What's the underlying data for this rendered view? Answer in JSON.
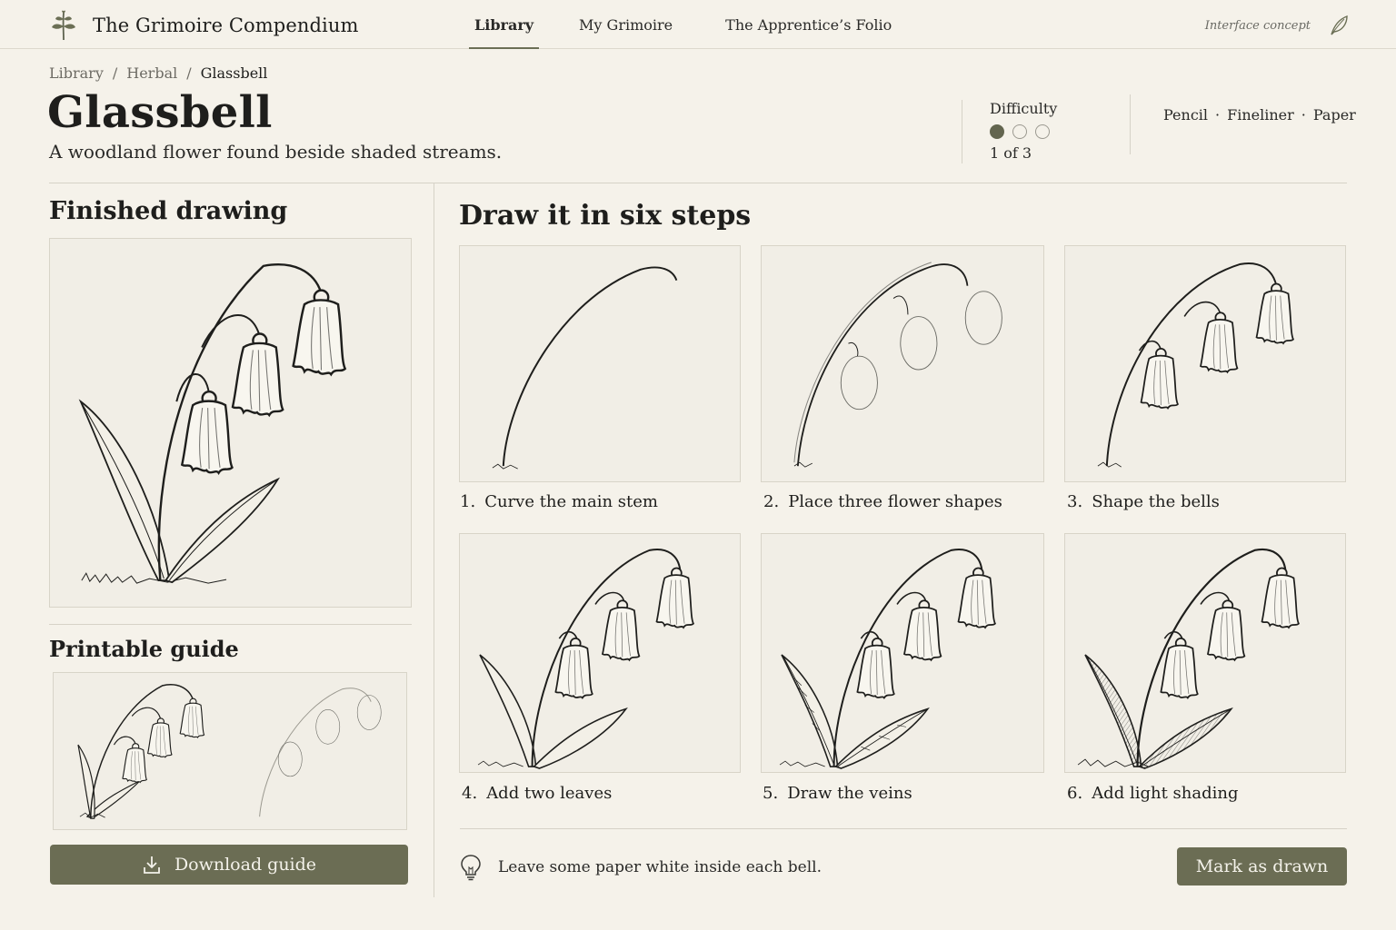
{
  "app": {
    "title": "The Grimoire Compendium",
    "concept_note": "Interface concept"
  },
  "nav": {
    "items": [
      {
        "label": "Library",
        "active": true
      },
      {
        "label": "My Grimoire",
        "active": false
      },
      {
        "label": "The Apprentice’s Folio",
        "active": false
      }
    ]
  },
  "breadcrumb": {
    "items": [
      "Library",
      "Herbal",
      "Glassbell"
    ],
    "separator": "/"
  },
  "entry": {
    "title": "Glassbell",
    "subtitle": "A woodland flower found beside shaded streams."
  },
  "difficulty": {
    "label": "Difficulty",
    "level": 1,
    "max": 3,
    "text": "1 of 3"
  },
  "materials": {
    "items": [
      "Pencil",
      "Fineliner",
      "Paper"
    ],
    "separator": "·"
  },
  "finished": {
    "heading": "Finished drawing"
  },
  "printable": {
    "heading": "Printable guide",
    "download_label": "Download guide"
  },
  "steps": {
    "heading": "Draw it in six steps",
    "items": [
      {
        "num": "1.",
        "label": "Curve the main stem"
      },
      {
        "num": "2.",
        "label": "Place three flower shapes"
      },
      {
        "num": "3.",
        "label": "Shape the bells"
      },
      {
        "num": "4.",
        "label": "Add two leaves"
      },
      {
        "num": "5.",
        "label": "Draw the veins"
      },
      {
        "num": "6.",
        "label": "Add light shading"
      }
    ]
  },
  "tip": {
    "text": "Leave some paper white inside each bell."
  },
  "actions": {
    "mark_drawn_label": "Mark as drawn"
  },
  "colors": {
    "accent": "#6b6d54",
    "background": "#f5f2ea",
    "ink": "#1e1e1c"
  }
}
